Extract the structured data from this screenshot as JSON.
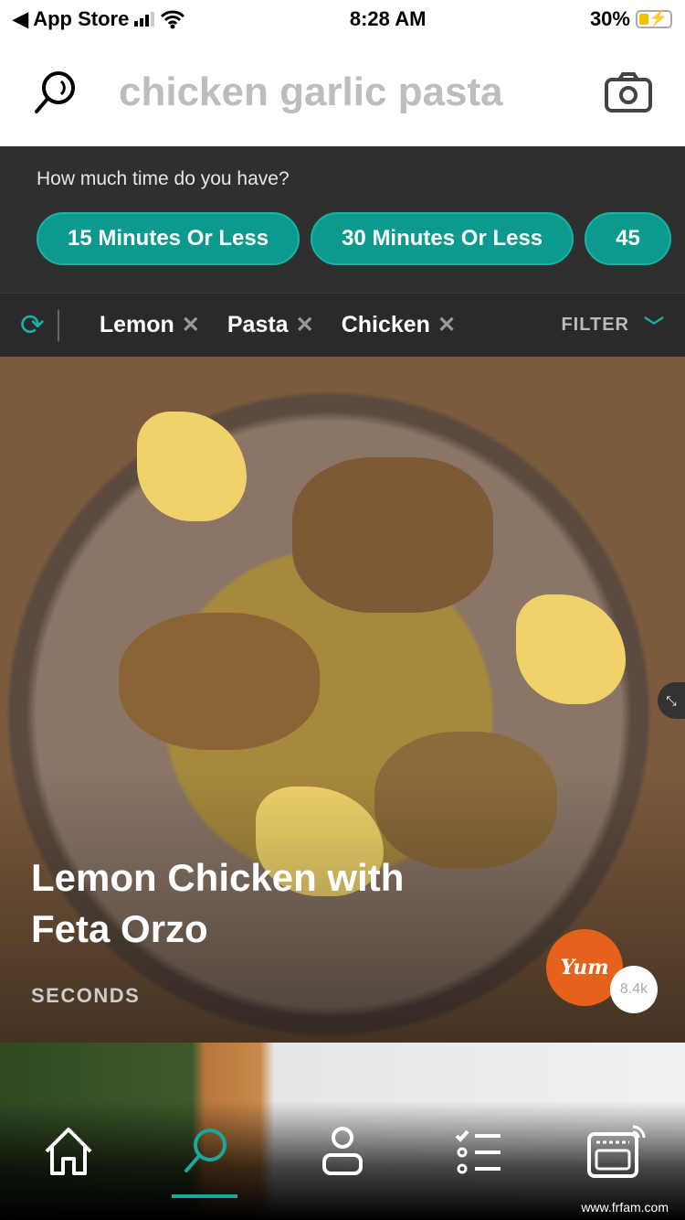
{
  "status_bar": {
    "back_label": "◀ App Store",
    "time": "8:28 AM",
    "battery": "30%"
  },
  "search": {
    "query": "chicken garlic pasta",
    "icon": "search-icon",
    "camera_icon": "camera-icon"
  },
  "time_filter": {
    "prompt": "How much time do you have?",
    "options": [
      "15 Minutes Or Less",
      "30 Minutes Or Less",
      "45"
    ]
  },
  "filters": {
    "chips": [
      "Lemon",
      "Pasta",
      "Chicken"
    ],
    "filter_label": "FILTER",
    "refresh_icon": "refresh-icon"
  },
  "recipe": {
    "title": "Lemon Chicken with Feta Orzo",
    "source": "SECONDS",
    "yum_label": "Yum",
    "yum_count": "8.4k",
    "brand_color": "#e5621c"
  },
  "tabbar": {
    "items": [
      "home",
      "search",
      "profile",
      "shopping-list",
      "smart-oven"
    ],
    "active": "search",
    "accent": "#19a89c"
  },
  "watermark": "www.frfam.com"
}
